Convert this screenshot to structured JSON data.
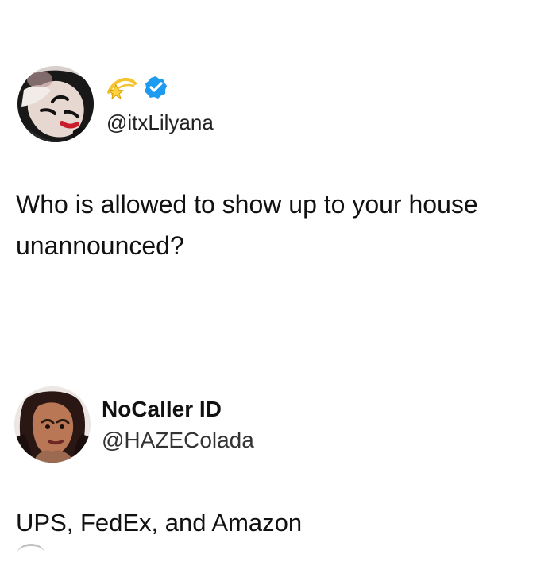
{
  "tweets": [
    {
      "avatar": "avatar-photo",
      "emoji_icon": "dizzy-star-emoji-icon",
      "verified_icon": "verified-badge-icon",
      "handle": "@itxLilyana",
      "text": "Who is allowed to show up to your house unannounced?"
    },
    {
      "avatar": "avatar-photo",
      "display_name": "NoCaller ID",
      "handle": "@HAZEColada",
      "text": "UPS, FedEx, and Amazon"
    }
  ],
  "colors": {
    "text_primary": "#111111",
    "text_secondary": "#333333",
    "verified_blue": "#1d9bf0",
    "emoji_yellow": "#f4c430"
  }
}
